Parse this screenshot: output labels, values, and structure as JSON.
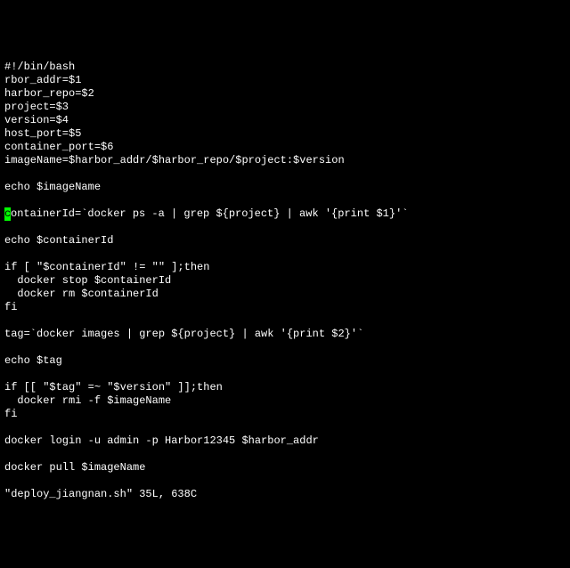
{
  "lines": [
    "#!/bin/bash",
    "rbor_addr=$1",
    "harbor_repo=$2",
    "project=$3",
    "version=$4",
    "host_port=$5",
    "container_port=$6",
    "imageName=$harbor_addr/$harbor_repo/$project:$version",
    "",
    "echo $imageName",
    "",
    {
      "cursor": "c",
      "rest": "ontainerId=`docker ps -a | grep ${project} | awk '{print $1}'`"
    },
    "",
    "echo $containerId",
    "",
    "if [ \"$containerId\" != \"\" ];then",
    "  docker stop $containerId",
    "  docker rm $containerId",
    "fi",
    "",
    "tag=`docker images | grep ${project} | awk '{print $2}'`",
    "",
    "echo $tag",
    "",
    "if [[ \"$tag\" =~ \"$version\" ]];then",
    "  docker rmi -f $imageName",
    "fi",
    "",
    "docker login -u admin -p Harbor12345 $harbor_addr",
    "",
    "docker pull $imageName",
    ""
  ],
  "status": "\"deploy_jiangnan.sh\" 35L, 638C"
}
